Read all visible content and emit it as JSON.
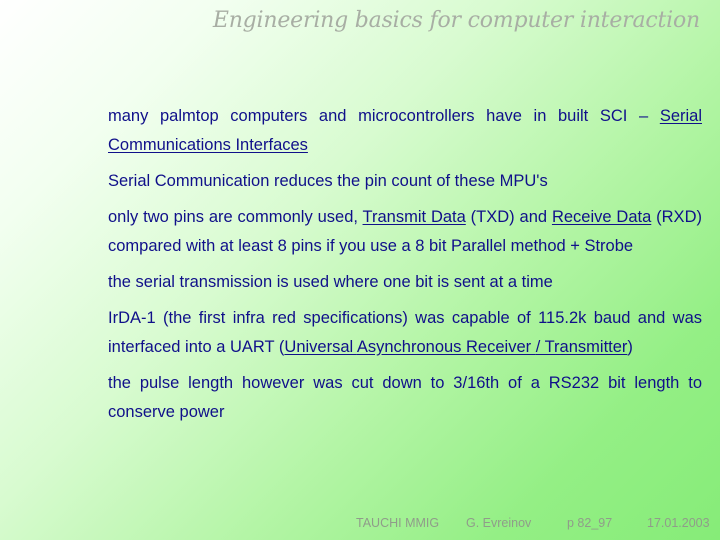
{
  "slide": {
    "title": "Engineering basics for computer interaction",
    "colors": {
      "text": "#10108a",
      "title": "#a8aea4",
      "footer": "#909c8a",
      "background_start": "#ffffff",
      "background_end": "#86ec78"
    }
  },
  "paragraphs": [
    {
      "parts": [
        {
          "text": "many palmtop computers and microcontrollers have in built SCI –  "
        },
        {
          "text": "Serial Communications Interfaces",
          "underline": true
        }
      ]
    },
    {
      "parts": [
        {
          "text": "Serial Communication reduces the pin count of these MPU's"
        }
      ]
    },
    {
      "parts": [
        {
          "text": "only two pins are commonly used, "
        },
        {
          "text": "Transmit Data",
          "underline": true
        },
        {
          "text": " (TXD) and "
        },
        {
          "text": "Receive Data",
          "underline": true
        },
        {
          "text": " (RXD) compared with at least 8 pins if you use a 8 bit Parallel method + Strobe"
        }
      ]
    },
    {
      "parts": [
        {
          "text": "the serial transmission is used where one bit is sent at a time"
        }
      ]
    },
    {
      "parts": [
        {
          "text": "IrDA-1 (the first infra red specifications) was capable of 115.2k baud and was interfaced into a UART ("
        },
        {
          "text": "Universal ",
          "underline": true
        },
        {
          "text": " "
        },
        {
          "text": "Asynchronous ",
          "underline": true
        },
        {
          "text": " "
        },
        {
          "text": "Receiver ",
          "underline": true
        },
        {
          "text": " "
        },
        {
          "text": "/ Transmitter",
          "underline": true
        },
        {
          "text": ")"
        }
      ]
    },
    {
      "parts": [
        {
          "text": "the pulse length however was cut down to 3/16th of a RS232 bit length to conserve power"
        }
      ]
    }
  ],
  "footer": {
    "organization": "TAUCHI MMIG",
    "author": "G. Evreinov",
    "page": "p 82_97",
    "date": "17.01.2003"
  }
}
